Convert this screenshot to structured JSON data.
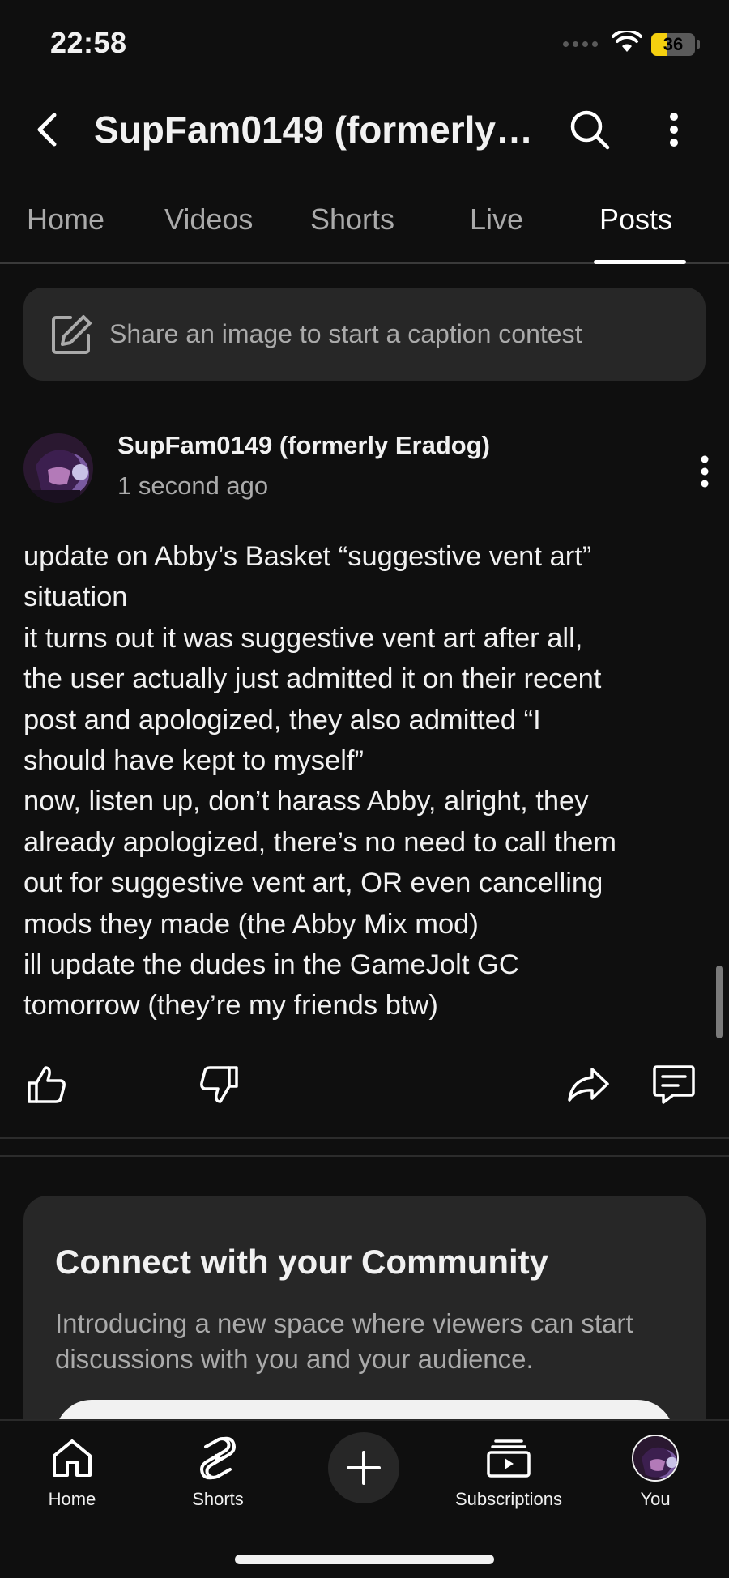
{
  "status_bar": {
    "time": "22:58",
    "battery": "36",
    "battery_level": 0.36
  },
  "header": {
    "title": "SupFam0149 (formerly…"
  },
  "tabs": [
    {
      "label": "Home",
      "active": false
    },
    {
      "label": "Videos",
      "active": false
    },
    {
      "label": "Shorts",
      "active": false
    },
    {
      "label": "Live",
      "active": false
    },
    {
      "label": "Posts",
      "active": true
    }
  ],
  "caption_contest": {
    "text": "Share an image to start a caption contest"
  },
  "post": {
    "author": "SupFam0149 (formerly Eradog)",
    "time": "1 second ago",
    "lines": [
      "update on Abby’s Basket “suggestive vent art”",
      "situation",
      "it turns out it was suggestive vent art after all,",
      "the user actually just admitted it on their recent",
      "post and apologized, they also admitted “I",
      "should have kept to myself”",
      "now, listen up, don’t harass Abby, alright, they",
      "already apologized, there’s no need to call them",
      "out for suggestive vent art, OR even cancelling",
      "mods they made (the Abby Mix mod)",
      "ill update the dudes in the GameJolt GC",
      "tomorrow (they’re my friends btw)"
    ]
  },
  "community": {
    "title": "Connect with your Community",
    "description": "Introducing a new space where viewers can start discussions with you and your audience."
  },
  "bottom_nav": {
    "home": "Home",
    "shorts": "Shorts",
    "subscriptions": "Subscriptions",
    "you": "You"
  },
  "colors": {
    "background": "#0f0f0f",
    "card": "#272727",
    "secondary_text": "#aaaaaa",
    "battery": "#f5d00f"
  }
}
